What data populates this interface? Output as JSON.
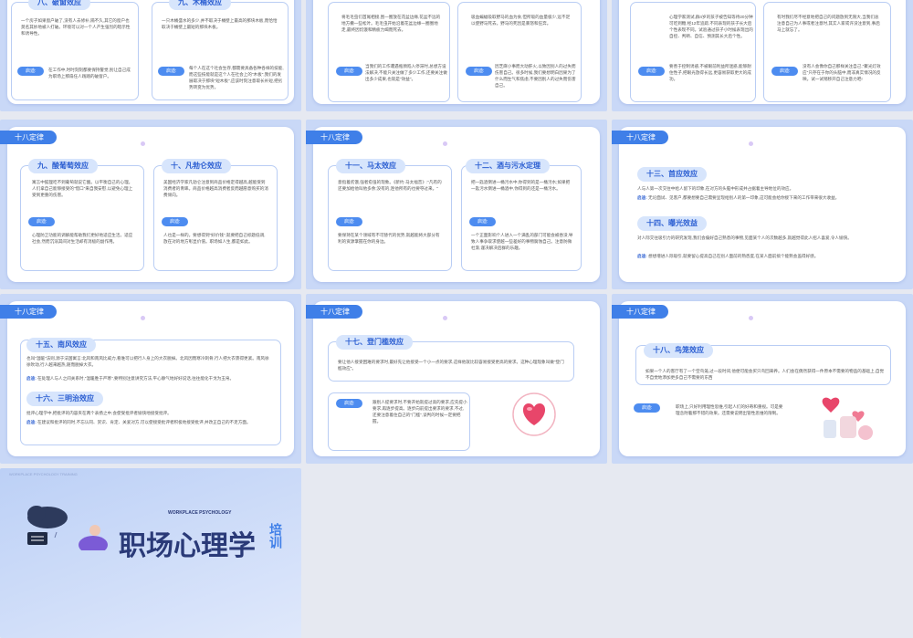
{
  "header_tag": "十八定律",
  "hint_label": "启迪:",
  "row0": {
    "c1_title": "八、破窗效应",
    "c1_text": "一个房子如果窗户破了,没有人去修补,隔不久,其它的窗户也莫名其妙地被人打破。环境可以对一个人产生强烈的暗示性和诱导性。",
    "c1_hint": "在工作中,时时刻刻都要保持警觉,别让自己成为职场上那扇任人践踏的破窗户。",
    "c2_title": "九、木桶效应",
    "c2_text": "一只木桶盛水的多少,并不取决于桶壁上最高的那块木板,而恰恰取决于桶壁上最短的那块木板。",
    "c2_hint": "每个人在这个社会生存,都需要具备各种各样的技能,而这些技能就是这个人在社会上的\"木板\",我们的发展取决于那块\"短木板\",应该时刻注意取长补短,把劣势转变为优势。",
    "s2_text": "将毛毛虫们首尾相接,围一圈放在花盆边缘,花盆不远的地方撒一些松叶。毛毛虫开始沿着花盆边缘一圈圈地走,最终因饥饿和精疲力竭而死去。",
    "s2_hint": "当我们的工作遭遇瓶颈陷入停滞时,总想方设法解决,不能只关注做了多少工作,还要关注做出多少成果,也就是\"效益\"。",
    "s2b_text": "吸血蝙蝠吸取野马的血为食,但所吸的血量极少,远不足以使野马死去。野马的死因是暴怒和狂奔。",
    "s2b_hint": "因芝麻小事而大动肝火,以致因别人的过失而伤害自己。很多时候,我们要想明白因果为了什么而生气和焦虑,不要因别人的过失而伤害自己。",
    "s3_text": "心理学家测试,群4岁的孩子被告知等待20分钟可吃到糖,经12年追踪,不同表现的孩子长大后个性表现不同。试验通过孩子小时候表现出的自控、判断、自信、预测其长大后个性。",
    "s3_hint": "要善于控制诱惑,不被眼前利益所迷惑,能够耐住性子,把眼光放得长远,更容易获取更大的成功。",
    "s3b_text": "有时我们尽不经意地把自己的问题放到无限大,当我们总注意自己为人事或者注意时,其实人家或许没注意到,事后马上就忘了。",
    "s3b_hint": "没有人会像你自己那样关注自己,\"聚光灯效应\"只存在于你的头脑中,而非真实情况的反映。试一试稍移开自己注意力吧!"
  },
  "row1": {
    "s1": {
      "c1_title": "九、酸葡萄效应",
      "c1_text": "寓言中狐狸吃不到葡萄就说它酸。以平衡自己的心理。人们拿自己能够接受的\"借口\"来自我安慰,以避免心理上受到更重的伤害。",
      "c1_hint": "心理防卫功能的调解能帮助我们更好地适应生活。适应社会,然而沉溺其间对生活却有消极的副作用。",
      "c2_title": "十、凡勃仑效应",
      "c2_text": "美国经济学家凡勃仑注意到商品价格定得越高,越能受到消费者的青睐。商品价格越高消费者反而越愿意购买的消费倾向。",
      "c2_hint": "人也是一样的。要想得到\"好价钱\",就要把自己标题低调,放在对的地方彰显价值。职场如人生,都是如此。"
    },
    "s2": {
      "c1_title": "十一、马太效应",
      "c1_text": "意指着贫饿,强者愈强的现象。《新约·马太福音》:\"凡有的还要加给他叫他多余;没有的,连他所有的也要夺过来。\"",
      "c1_hint": "要保持在某个领域有不可替代的优势,就越能将大部分有利的资源掌握在你的身边。",
      "c2_title": "十二、酒与污水定理",
      "c2_text": "把一匙酒倒进一桶污水中,你得到的是一桶污水;如果把一匙污水倒进一桶酒中,你得到的还是一桶污水。",
      "c2_hint": "一个正面影响个人进入一个满乱的部门可能会被吞没,导致人事争取求使越一些差好的事物腐蚀自己。注意防微杜渐,谨决解决后群的乐趣。"
    },
    "s3": {
      "c1_title": "十三、首应效应",
      "c1_text": "人与人第一次交往中给人留下的印象,在对方的头脑中形成并占据着主导地位的效应。",
      "c1_hint": "无论面试、见客户,都要想要自己需要呈现给别人的第一印象,这可能会给你接下来的工作带来很大收益。",
      "c2_title": "十四、曝光效益",
      "c2_text": "对人际交往吸引力的研究发现,我们会偏好自己熟悉的事物,见面某个人的次数越多,就越觉得此人招人喜爱,令人愉快。",
      "c2_hint": "想想增进人际吸引,就要留心提高自己在别人面前的熟悉度,在某人面前搞个能熟会盖得好感。"
    }
  },
  "row2": {
    "s1": {
      "c1_title": "十五、南风效应",
      "c1_text": "也叫\"温暖\"法则,源于法国寓言:北风和南风比威力,看谁可以把行人身上的大衣脱掉。北风因而寒冷刺骨,行人把大衣裹得更紧。南风徐徐吹动,行人越来越热,随而脱掉大衣。",
      "c1_hint": "在处理人与人之间关系时,\"温暖胜于严寒\",要特别注意讲究方法,平心静气地好好说话,往往能化干戈为玉帛。",
      "c2_title": "十六、三明治效应",
      "c2_text": "批评心理学中,把批评的内容夹在两个表扬之中,会使受批评者愉快地接受批评。",
      "c2_hint": "在建议和批评的同时,不忘认同、赏识、肯定、关爱对方,可以使接受批评者积极地接受批评,并改正自己的不足方面。"
    },
    "s2": {
      "c1_title": "十七、登门槛效应",
      "c1_text": "要让他人接受困难的要求时,最好先让他接受一个小一点的要求,这样他就比较容易接受更高的要求。这种心理现象叫做\"登门槛效应\"。",
      "c1_hint": "跟别人提要求时,不要开始就提过高的要求,应先提小要求,再逐步提高。逐步向前提出要求的要求,不过,还要注意着住自己的\"门槛\",谈判的时候一定要把握。"
    },
    "s3": {
      "c1_title": "十八、鸟笼效应",
      "c1_text": "如果一个人的客厅有了一个空鸟笼,过一段时间,他便可能会买只鸟回来养。人们会在偶然获得一件原本不需要的物品的基础上,自觉不自觉地添加更多自己不需要的东西",
      "c1_hint": "职场上,只好利用理性思维,引起人们的好奇和重视。可是要理念附着那不错的效果。还需要说明出管性思维的限制。"
    }
  },
  "cover": {
    "small_top": "WORKPLACE PSYCHOLOGY TRAINING",
    "eng": "WORKPLACE PSYCHOLOGY",
    "title": "职场心理学",
    "side": "培训"
  }
}
